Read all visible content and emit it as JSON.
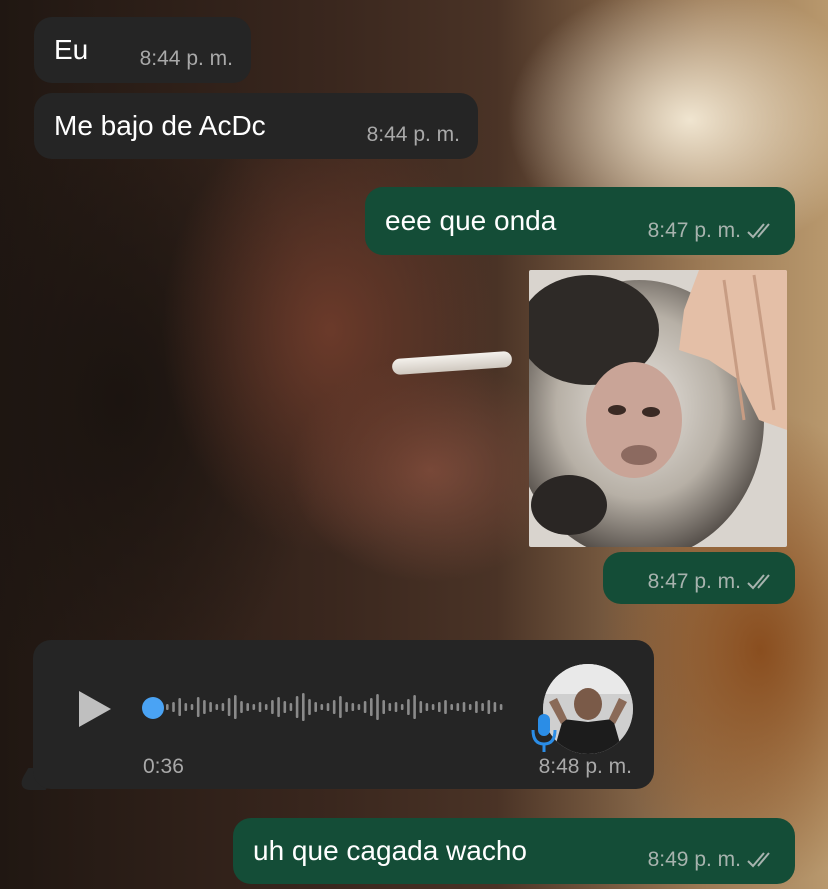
{
  "messages": [
    {
      "type": "incoming",
      "text": "Eu",
      "time": "8:44 p. m."
    },
    {
      "type": "incoming",
      "text": "Me bajo de AcDc",
      "time": "8:44 p. m."
    },
    {
      "type": "outgoing",
      "text": "eee que onda",
      "time": "8:47 p. m."
    },
    {
      "type": "outgoing_image",
      "time": "8:47 p. m."
    },
    {
      "type": "incoming_voice",
      "duration": "0:36",
      "time": "8:48 p. m.",
      "progress": 0.0
    },
    {
      "type": "outgoing",
      "text": "uh que cagada wacho",
      "time": "8:49 p. m."
    }
  ],
  "colors": {
    "incoming_bubble": "#252525",
    "outgoing_bubble": "#144d37",
    "meta_text": "#a9a9a9",
    "voice_accent": "#4aa3f4"
  },
  "icons": [
    "double-check-icon",
    "play-icon",
    "microphone-icon",
    "avatar"
  ]
}
